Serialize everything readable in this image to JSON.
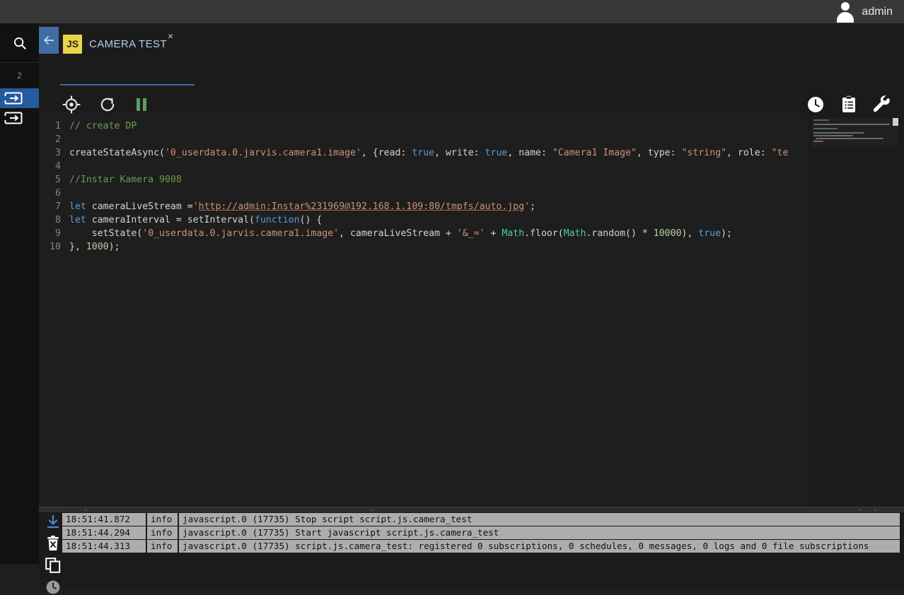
{
  "topbar": {
    "username": "admin",
    "avatar_icon": "user-avatar-icon"
  },
  "rail": {
    "search_icon": "search-icon",
    "count_label": "2",
    "items": [
      {
        "icon": "script-import-icon",
        "active": true
      },
      {
        "icon": "script-import-icon",
        "active": false
      }
    ]
  },
  "tab": {
    "back_icon": "arrow-left-icon",
    "badge_label": "JS",
    "title": "CAMERA TEST",
    "close_label": "×"
  },
  "editor_toolbar": {
    "left_buttons": [
      {
        "name": "select-target-button",
        "icon": "crosshair-icon"
      },
      {
        "name": "restart-script-button",
        "icon": "refresh-icon"
      },
      {
        "name": "pause-script-button",
        "icon": "pause-icon",
        "color": "#5c9e5c"
      }
    ],
    "right_buttons": [
      {
        "name": "history-button",
        "icon": "clock-icon"
      },
      {
        "name": "clipboard-button",
        "icon": "clipboard-icon"
      },
      {
        "name": "settings-button",
        "icon": "wrench-icon"
      }
    ]
  },
  "editor": {
    "language": "javascript",
    "lines": [
      {
        "n": "1",
        "tokens": [
          {
            "t": "// create DP",
            "c": "tk-com"
          }
        ]
      },
      {
        "n": "2",
        "tokens": []
      },
      {
        "n": "3",
        "tokens": [
          {
            "t": "createStateAsync(",
            "c": ""
          },
          {
            "t": "'0_userdata.0.jarvis.camera1.image'",
            "c": "tk-str"
          },
          {
            "t": ", {read: ",
            "c": ""
          },
          {
            "t": "true",
            "c": "tk-key"
          },
          {
            "t": ", write: ",
            "c": ""
          },
          {
            "t": "true",
            "c": "tk-key"
          },
          {
            "t": ", name: ",
            "c": ""
          },
          {
            "t": "\"Camera1 Image\"",
            "c": "tk-str"
          },
          {
            "t": ", type: ",
            "c": ""
          },
          {
            "t": "\"string\"",
            "c": "tk-str"
          },
          {
            "t": ", role: ",
            "c": ""
          },
          {
            "t": "\"te",
            "c": "tk-str"
          }
        ]
      },
      {
        "n": "4",
        "tokens": []
      },
      {
        "n": "5",
        "tokens": [
          {
            "t": "//Instar Kamera 9008",
            "c": "tk-com"
          }
        ]
      },
      {
        "n": "6",
        "tokens": []
      },
      {
        "n": "7",
        "tokens": [
          {
            "t": "let",
            "c": "tk-key"
          },
          {
            "t": " cameraLiveStream =",
            "c": ""
          },
          {
            "t": "'",
            "c": "tk-str"
          },
          {
            "t": "http://admin:Instar%231969@192.168.1.109:80/tmpfs/auto.jpg",
            "c": "tk-url"
          },
          {
            "t": "'",
            "c": "tk-str"
          },
          {
            "t": ";",
            "c": ""
          }
        ]
      },
      {
        "n": "8",
        "tokens": [
          {
            "t": "let",
            "c": "tk-key"
          },
          {
            "t": " cameraInterval = setInterval(",
            "c": ""
          },
          {
            "t": "function",
            "c": "tk-key"
          },
          {
            "t": "() {",
            "c": ""
          }
        ]
      },
      {
        "n": "9",
        "tokens": [
          {
            "t": "    setState(",
            "c": ""
          },
          {
            "t": "'0_userdata.0.jarvis.camera1.image'",
            "c": "tk-str"
          },
          {
            "t": ", cameraLiveStream + ",
            "c": ""
          },
          {
            "t": "'&_='",
            "c": "tk-str"
          },
          {
            "t": " + ",
            "c": ""
          },
          {
            "t": "Math",
            "c": "tk-cls"
          },
          {
            "t": ".floor(",
            "c": ""
          },
          {
            "t": "Math",
            "c": "tk-cls"
          },
          {
            "t": ".random() * ",
            "c": ""
          },
          {
            "t": "10000",
            "c": "tk-num"
          },
          {
            "t": "), ",
            "c": ""
          },
          {
            "t": "true",
            "c": "tk-key"
          },
          {
            "t": ");",
            "c": ""
          }
        ]
      },
      {
        "n": "10",
        "tokens": [
          {
            "t": "}, ",
            "c": ""
          },
          {
            "t": "1000",
            "c": "tk-num"
          },
          {
            "t": ");",
            "c": ""
          }
        ]
      }
    ]
  },
  "logpanel": {
    "icons": [
      {
        "name": "scroll-to-bottom-button",
        "icon": "download-arrow-icon",
        "color": "#4a88c7"
      },
      {
        "name": "clear-log-button",
        "icon": "trash-x-icon",
        "color": "#ffffff"
      },
      {
        "name": "copy-log-button",
        "icon": "copy-icon",
        "color": "#ffffff"
      },
      {
        "name": "record-log-button",
        "icon": "circle-icon",
        "color": "#9a9a9a"
      }
    ],
    "columns": [
      "time",
      "severity",
      "message"
    ],
    "rows": [
      {
        "time": "18:51:41.872",
        "severity": "info",
        "message": "javascript.0 (17735) Stop script script.js.camera_test"
      },
      {
        "time": "18:51:44.294",
        "severity": "info",
        "message": "javascript.0 (17735) Start javascript script.js.camera_test"
      },
      {
        "time": "18:51:44.313",
        "severity": "info",
        "message": "javascript.0 (17735) script.js.camera_test: registered 0 subscriptions, 0 schedules, 0 messages, 0 logs and 0 file subscriptions"
      }
    ]
  },
  "colors": {
    "accent": "#3f6da3",
    "topbar_bg": "#383838",
    "editor_bg": "#1e1e1e",
    "panel_bg": "#1b1b1b",
    "log_row_bg": "#adadad",
    "js_badge": "#e8d44d",
    "pause_green": "#5c9e5c"
  }
}
